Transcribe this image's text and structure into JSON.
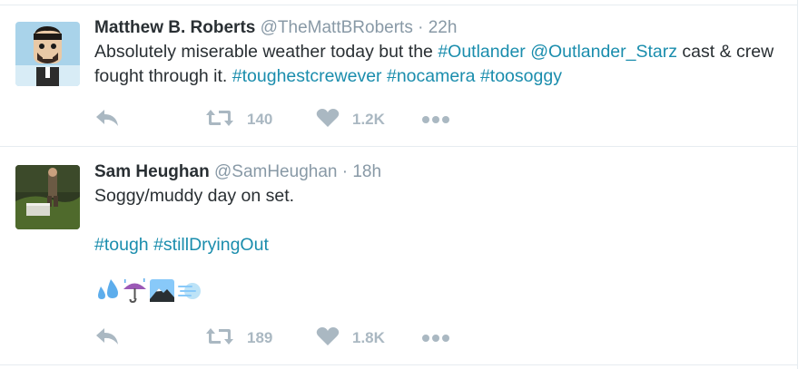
{
  "tweets": [
    {
      "fullname": "Matthew B. Roberts",
      "username": "@TheMattBRoberts",
      "separator": "·",
      "time": "22h",
      "text_parts": {
        "p1": "Absolutely miserable weather today but the ",
        "l1": "#Outlander",
        "p2": " ",
        "l2": "@Outlander_Starz",
        "p3": " cast & crew fought through it. ",
        "l3": "#toughestcrewever",
        "p4": " ",
        "l4": "#nocamera",
        "p5": " ",
        "l5": "#toosoggy"
      },
      "retweets": "140",
      "likes": "1.2K"
    },
    {
      "fullname": "Sam Heughan",
      "username": "@SamHeughan",
      "separator": "·",
      "time": "18h",
      "text_line1": "Soggy/muddy day on set.",
      "hashtags": {
        "h1": "#tough",
        "sp": " ",
        "h2": "#stillDryingOut"
      },
      "emojis": [
        "sweat-droplets",
        "umbrella-with-rain",
        "snow-capped-mountain",
        "wind-blowing"
      ],
      "retweets": "189",
      "likes": "1.8K"
    }
  ],
  "colors": {
    "link": "#1a8dad",
    "action_gray": "#aab8c2",
    "text": "#292f33",
    "meta": "#8899a6"
  }
}
